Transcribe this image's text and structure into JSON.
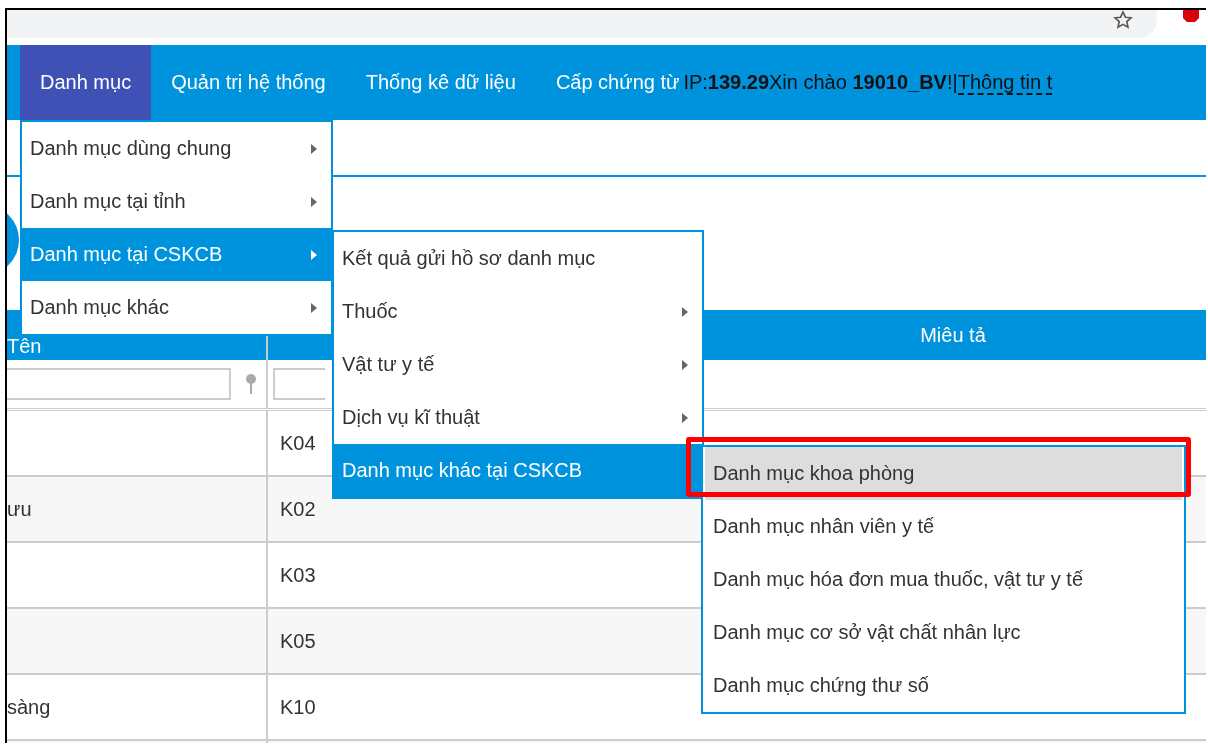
{
  "nav": [
    {
      "label": "Danh mục",
      "selected": true
    },
    {
      "label": "Quản trị hệ thống",
      "selected": false
    },
    {
      "label": "Thống kê dữ liệu",
      "selected": false
    },
    {
      "label": "Cấp chứng từ",
      "selected": false
    }
  ],
  "user_info": {
    "text": "IP:**139.29**Xin chào **19010_BV**!|",
    "link": "Thông tin t"
  },
  "menu": {
    "items": [
      {
        "label": "Danh mục dùng chung",
        "selected": false,
        "has_submenu": true
      },
      {
        "label": "Danh mục tại tỉnh",
        "selected": false,
        "has_submenu": true
      },
      {
        "label": "Danh mục tại CSKCB",
        "selected": true,
        "has_submenu": true
      },
      {
        "label": "Danh mục khác",
        "selected": false,
        "has_submenu": true
      }
    ]
  },
  "submenu": {
    "items": [
      {
        "label": "Kết quả gửi hồ sơ danh mục",
        "selected": false,
        "has_submenu": false
      },
      {
        "label": "Thuốc",
        "selected": false,
        "has_submenu": true
      },
      {
        "label": "Vật tư y tế",
        "selected": false,
        "has_submenu": true
      },
      {
        "label": "Dịch vụ kĩ thuật",
        "selected": false,
        "has_submenu": true
      },
      {
        "label": "Danh mục khác tại CSKCB",
        "selected": true,
        "has_submenu": false
      }
    ]
  },
  "submenu_2": {
    "items": [
      {
        "label": "Danh mục khoa phòng",
        "selected": true,
        "marked": true
      },
      {
        "label": "Danh mục nhân viên y tế",
        "selected": false,
        "marked": false
      },
      {
        "label": "Danh mục hóa đơn mua thuốc, vật tư y tế",
        "selected": false,
        "marked": false
      },
      {
        "label": "Danh mục cơ sở vật chất nhân lực",
        "selected": false,
        "marked": false
      },
      {
        "label": "Danh mục chứng thư số",
        "selected": false,
        "marked": false
      }
    ]
  },
  "table": {
    "column_1": "Tên",
    "column_3": "Miêu tả",
    "rows": [
      {
        "code": "K04"
      },
      {
        "name": "ưu",
        "code": "K02"
      },
      {
        "code": "K03"
      },
      {
        "code": "K05"
      },
      {
        "name": "sàng",
        "code": "K10"
      }
    ]
  }
}
